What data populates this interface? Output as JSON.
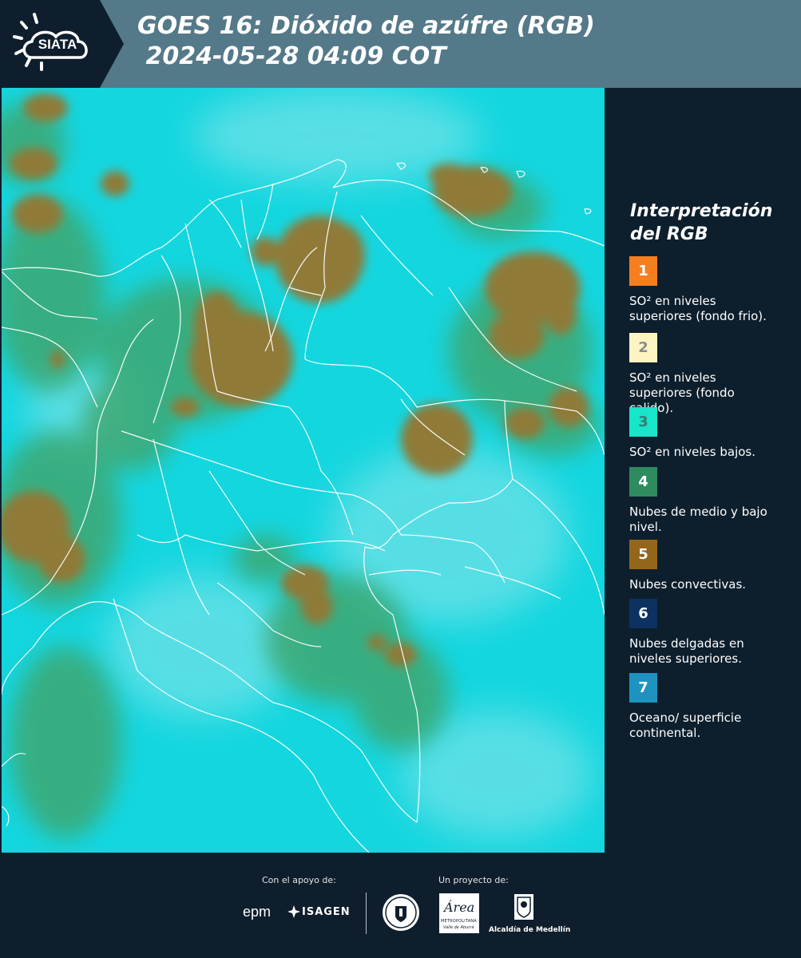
{
  "header": {
    "logo_text": "SIATA",
    "title_line1": "GOES 16: Dióxido de azúfre (RGB)",
    "title_line2": " 2024-05-28 04:09 COT",
    "background_color": "#547989"
  },
  "map": {
    "background_color": "#14d6df",
    "low_cloud_color": "#3fa56c",
    "convective_cloud_color": "#8f7a38",
    "border_color": "#ffffff"
  },
  "legend": {
    "title": "Interpretación del RGB",
    "items": [
      {
        "number": "1",
        "label": "SO² en niveles superiores (fondo frio).",
        "color": "#f57e1f",
        "number_color": "#ffffff"
      },
      {
        "number": "2",
        "label": "SO² en niveles superiores (fondo calido).",
        "color": "#fcf5c2",
        "number_color": "#8b8b8b"
      },
      {
        "number": "3",
        "label": "SO² en niveles bajos.",
        "color": "#17e6c8",
        "number_color": "#2f7f76"
      },
      {
        "number": "4",
        "label": "Nubes de medio y bajo nivel.",
        "color": "#2f8a5e",
        "number_color": "#ffffff"
      },
      {
        "number": "5",
        "label": "Nubes convectivas.",
        "color": "#946619",
        "number_color": "#ffffff"
      },
      {
        "number": "6",
        "label": "Nubes delgadas en niveles superiores.",
        "color": "#0d3160",
        "number_color": "#ffffff"
      },
      {
        "number": "7",
        "label": "Oceano/ superficie continental.",
        "color": "#1e93c0",
        "number_color": "#ffffff"
      }
    ]
  },
  "footer": {
    "support_caption": "Con el apoyo de:",
    "project_caption": "Un proyecto de:",
    "logos": {
      "epm": "epm",
      "isagen": "ISAGEN",
      "area_name": "Área",
      "area_sub": "METROPOLITANA",
      "area_sub2": "Valle de Aburrá",
      "alcaldia": "Alcaldía de Medellín"
    }
  }
}
